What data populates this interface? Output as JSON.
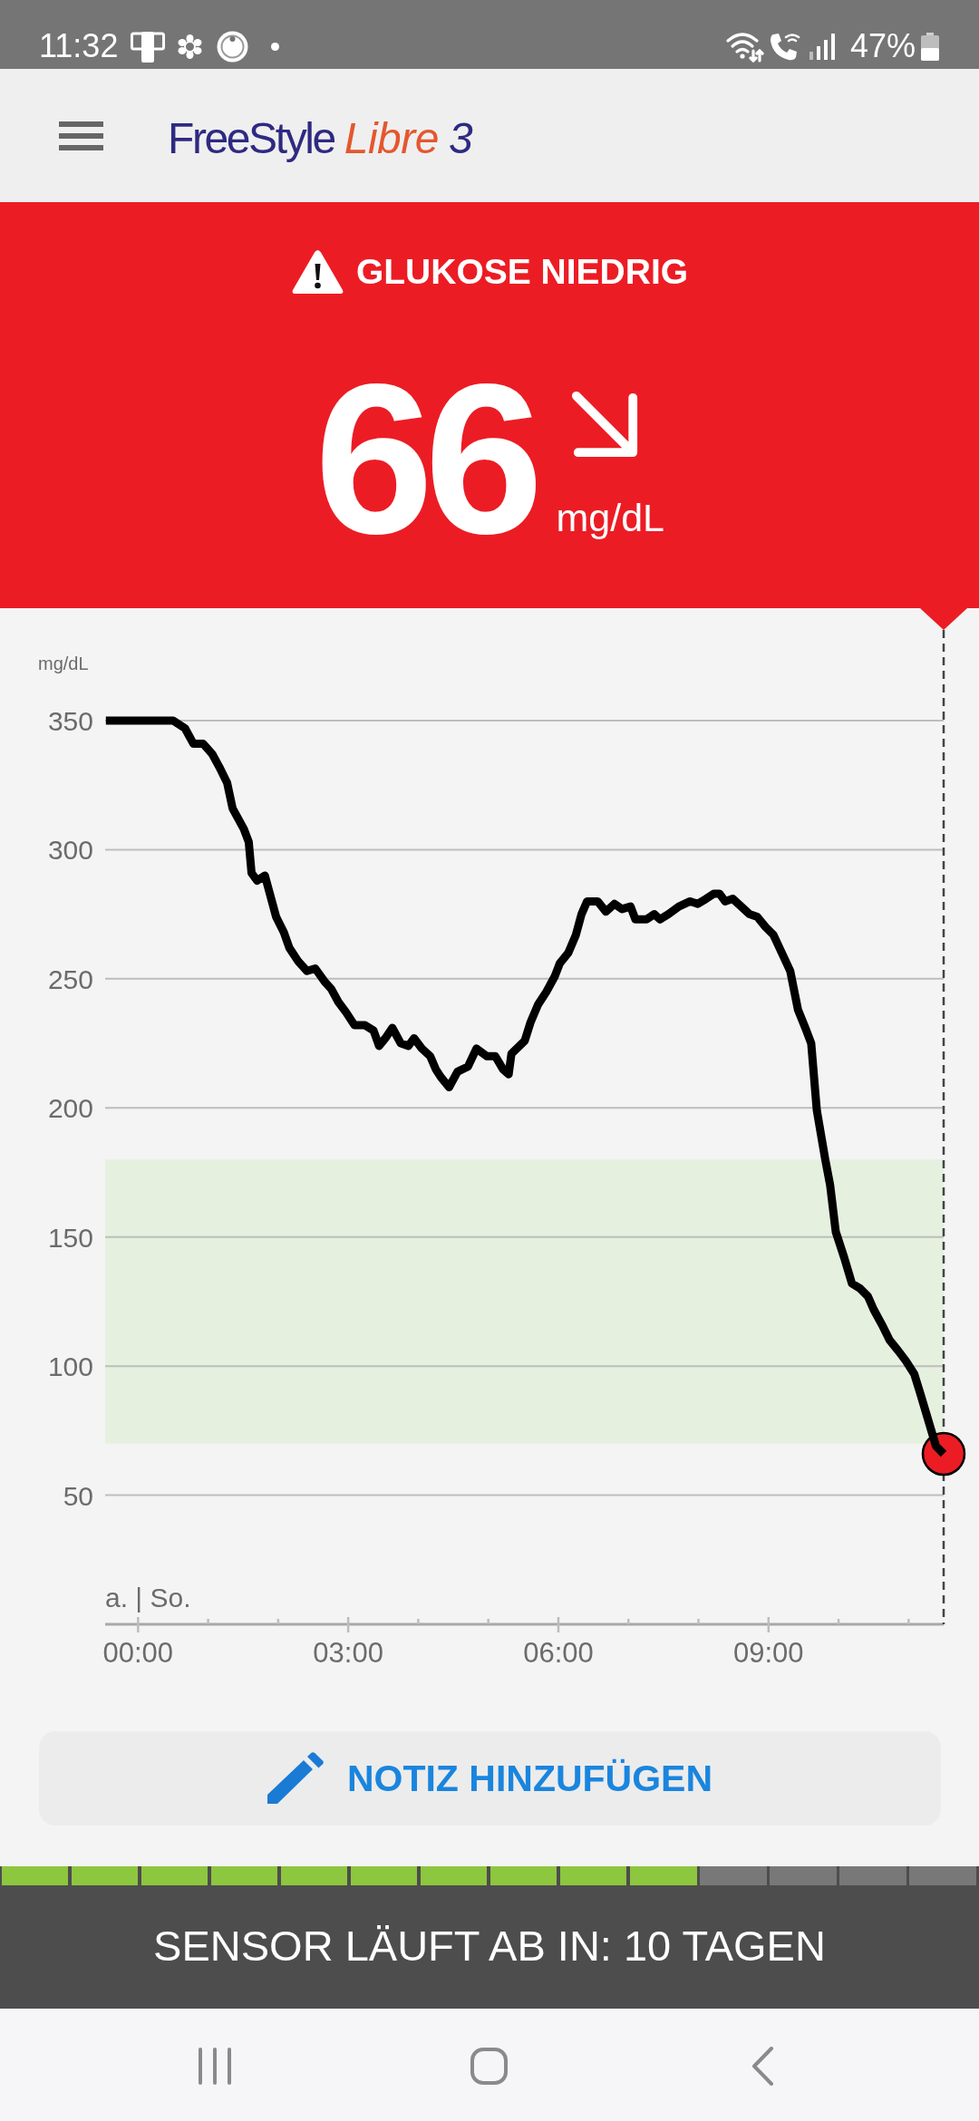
{
  "status_bar": {
    "time": "11:32",
    "battery": "47%"
  },
  "header": {
    "logo": {
      "brand": "FreeStyle",
      "product": "Libre",
      "version": "3"
    }
  },
  "reading": {
    "kind": "low",
    "alert": "GLUKOSE NIEDRIG",
    "value": "66",
    "unit": "mg/dL"
  },
  "chart": {
    "chart_data": {
      "type": "line",
      "ylabel": "mg/dL",
      "x": [
        -0.46,
        0.5,
        0.67,
        0.79,
        0.93,
        1.06,
        1.16,
        1.27,
        1.35,
        1.51,
        1.58,
        1.62,
        1.7,
        1.81,
        1.97,
        2.08,
        2.16,
        2.28,
        2.41,
        2.53,
        2.66,
        2.76,
        2.86,
        2.97,
        3.09,
        3.24,
        3.36,
        3.44,
        3.53,
        3.63,
        3.75,
        3.86,
        3.94,
        4.05,
        4.17,
        4.25,
        4.32,
        4.44,
        4.56,
        4.71,
        4.83,
        4.98,
        5.1,
        5.21,
        5.29,
        5.33,
        5.52,
        5.6,
        5.71,
        5.83,
        5.95,
        6.02,
        6.14,
        6.25,
        6.33,
        6.41,
        6.56,
        6.68,
        6.8,
        6.91,
        7.03,
        7.1,
        7.26,
        7.37,
        7.45,
        7.57,
        7.72,
        7.88,
        7.99,
        8.11,
        8.22,
        8.3,
        8.38,
        8.49,
        8.61,
        8.73,
        8.84,
        8.96,
        9.07,
        9.19,
        9.31,
        9.42,
        9.54,
        9.61,
        9.69,
        9.81,
        9.88,
        9.96,
        10.08,
        10.19,
        10.31,
        10.42,
        10.5,
        10.62,
        10.73,
        10.85,
        10.96,
        11.08,
        11.16,
        11.27,
        11.39,
        11.5
      ],
      "series": [
        {
          "color": "#000000",
          "values": [
            350,
            350,
            347,
            341,
            341,
            337,
            332,
            326,
            316,
            308,
            303,
            291,
            288,
            290,
            274,
            268,
            262,
            257,
            253,
            254,
            249,
            246,
            241,
            237,
            232,
            232,
            230,
            224,
            227,
            231,
            225,
            224,
            227,
            223,
            220,
            215,
            212,
            208,
            214,
            216,
            223,
            220,
            220,
            215,
            213,
            221,
            226,
            233,
            240,
            245,
            251,
            256,
            260,
            267,
            275,
            280,
            280,
            276,
            279,
            277,
            278,
            273,
            273,
            275,
            273,
            275,
            278,
            280,
            279,
            281,
            283,
            283,
            280,
            281,
            278,
            275,
            274,
            270,
            267,
            260,
            253,
            238,
            230,
            225,
            199,
            180,
            170,
            152,
            142,
            132,
            130,
            127,
            122,
            116,
            110,
            106,
            102,
            97,
            90,
            80,
            69,
            66
          ]
        }
      ],
      "xlim": [
        -0.47,
        11.5
      ],
      "ylim": [
        0,
        350
      ],
      "xticks": [
        {
          "value": 0,
          "label": "00:00"
        },
        {
          "value": 3,
          "label": "03:00"
        },
        {
          "value": 6,
          "label": "06:00"
        },
        {
          "value": 9,
          "label": "09:00"
        }
      ],
      "yticks": [
        50,
        100,
        150,
        200,
        250,
        300,
        350
      ],
      "grid": true,
      "bands": [
        {
          "axis": "y",
          "from": 70,
          "to": 180,
          "color": "#e6f0df"
        }
      ]
    },
    "date_label": "a. | So."
  },
  "note_button": {
    "label": "NOTIZ HINZUFÜGEN"
  },
  "sensor": {
    "level": 0.714,
    "label": "SENSOR LÄUFT AB IN: 10 TAGEN"
  }
}
